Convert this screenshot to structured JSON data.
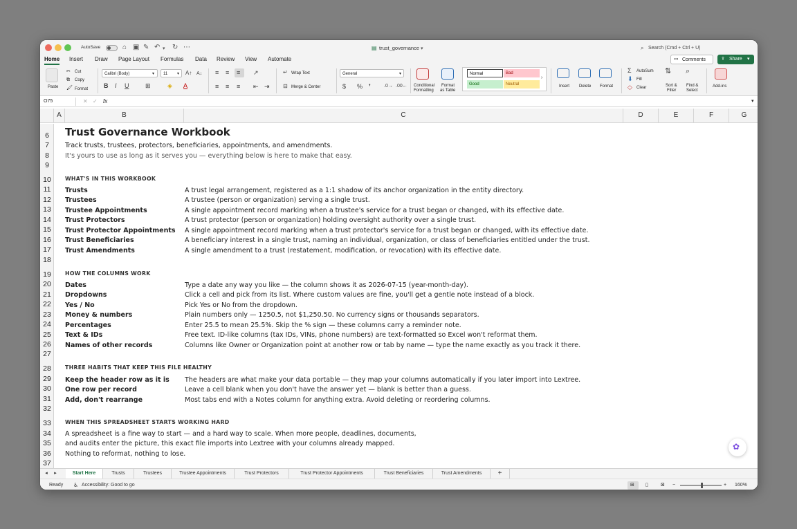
{
  "window": {
    "autosave": "AutoSave",
    "doc_title": "trust_governance",
    "search": "Search (Cmd + Ctrl + U)"
  },
  "menus": [
    "Home",
    "Insert",
    "Draw",
    "Page Layout",
    "Formulas",
    "Data",
    "Review",
    "View",
    "Automate"
  ],
  "comments_label": "Comments",
  "share_label": "Share",
  "ribbon": {
    "paste": "Paste",
    "cut": "Cut",
    "copy": "Copy",
    "format": "Format",
    "font_name": "Calibri (Body)",
    "font_size": "11",
    "wrap_text": "Wrap Text",
    "merge_center": "Merge & Center",
    "number_format": "General",
    "conditional": "Conditional",
    "formatting": "Formatting",
    "format_as": "Format",
    "as_table": "as Table",
    "style_normal": "Normal",
    "style_bad": "Bad",
    "style_good": "Good",
    "style_neutral": "Neutral",
    "insert": "Insert",
    "delete": "Delete",
    "format_cells": "Format",
    "autosum": "AutoSum",
    "fill": "Fill",
    "clear": "Clear",
    "sort": "Sort &",
    "filter": "Filter",
    "find": "Find &",
    "select": "Select",
    "addins": "Add-ins"
  },
  "formula_bar": {
    "name_box": "O75",
    "fx": "fx",
    "value": ""
  },
  "columns": [
    "A",
    "B",
    "C",
    "D",
    "E",
    "F",
    "G"
  ],
  "row_numbers": [
    "6",
    "7",
    "8",
    "9",
    "10",
    "11",
    "12",
    "13",
    "14",
    "15",
    "16",
    "17",
    "18",
    "19",
    "20",
    "21",
    "22",
    "23",
    "24",
    "25",
    "26",
    "27",
    "28",
    "29",
    "30",
    "31",
    "32",
    "33",
    "34",
    "35",
    "36",
    "37"
  ],
  "sheet": {
    "title": "Trust Governance Workbook",
    "intro1": "Track trusts, trustees, protectors, beneficiaries, appointments, and amendments.",
    "intro2": "It's yours to use as long as it serves you — everything below is here to make that easy.",
    "section1": "WHAT'S IN THIS WORKBOOK",
    "contents": [
      {
        "label": "Trusts",
        "desc": "A trust legal arrangement, registered as a 1:1 shadow of its anchor organization in the entity directory."
      },
      {
        "label": "Trustees",
        "desc": "A trustee (person or organization) serving a single trust."
      },
      {
        "label": "Trustee Appointments",
        "desc": "A single appointment record marking when a trustee's service for a trust began or changed, with its effective date."
      },
      {
        "label": "Trust Protectors",
        "desc": "A trust protector (person or organization) holding oversight authority over a single trust."
      },
      {
        "label": "Trust Protector Appointments",
        "desc": "A single appointment record marking when a trust protector's service for a trust began or changed, with its effective date."
      },
      {
        "label": "Trust Beneficiaries",
        "desc": "A beneficiary interest in a single trust, naming an individual, organization, or class of beneficiaries entitled under the trust."
      },
      {
        "label": "Trust Amendments",
        "desc": "A single amendment to a trust (restatement, modification, or revocation) with its effective date."
      }
    ],
    "section2": "HOW THE COLUMNS WORK",
    "columns_help": [
      {
        "label": "Dates",
        "desc": "Type a date any way you like — the column shows it as 2026-07-15 (year-month-day)."
      },
      {
        "label": "Dropdowns",
        "desc": "Click a cell and pick from its list. Where custom values are fine, you'll get a gentle note instead of a block."
      },
      {
        "label": "Yes / No",
        "desc": "Pick Yes or No from the dropdown."
      },
      {
        "label": "Money & numbers",
        "desc": "Plain numbers only — 1250.5, not $1,250.50. No currency signs or thousands separators."
      },
      {
        "label": "Percentages",
        "desc": "Enter 25.5 to mean 25.5%. Skip the % sign — these columns carry a reminder note."
      },
      {
        "label": "Text & IDs",
        "desc": "Free text. ID-like columns (tax IDs, VINs, phone numbers) are text-formatted so Excel won't reformat them."
      },
      {
        "label": "Names of other records",
        "desc": "Columns like Owner or Organization point at another row or tab by name — type the name exactly as you track it there."
      }
    ],
    "section3": "THREE HABITS THAT KEEP THIS FILE HEALTHY",
    "habits": [
      {
        "label": "Keep the header row as it is",
        "desc": "The headers are what make your data portable — they map your columns automatically if you later import into Lextree."
      },
      {
        "label": "One row per record",
        "desc": "Leave a cell blank when you don't have the answer yet — blank is better than a guess."
      },
      {
        "label": "Add, don't rearrange",
        "desc": "Most tabs end with a Notes column for anything extra. Avoid deleting or reordering columns."
      }
    ],
    "section4": "WHEN THIS SPREADSHEET STARTS WORKING HARD",
    "outro1": "A spreadsheet is a fine way to start — and a hard way to scale. When more people, deadlines, documents,",
    "outro2": "and audits enter the picture, this exact file imports into Lextree with your columns already mapped.",
    "outro3": "Nothing to reformat, nothing to lose."
  },
  "tabs": [
    "Start Here",
    "Trusts",
    "Trustees",
    "Trustee Appointments",
    "Trust Protectors",
    "Trust Protector Appointments",
    "Trust Beneficiaries",
    "Trust Amendments"
  ],
  "status": {
    "ready": "Ready",
    "accessibility": "Accessibility: Good to go",
    "zoom": "160%"
  }
}
